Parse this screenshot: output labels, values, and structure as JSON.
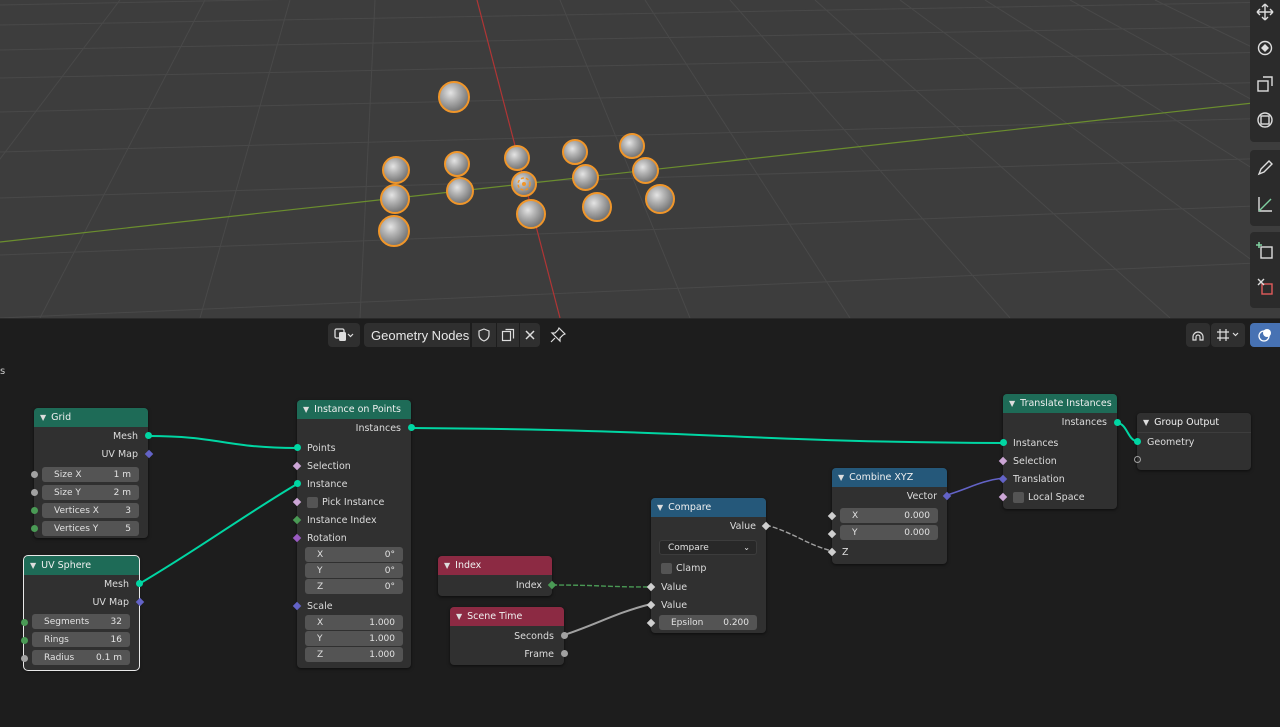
{
  "editor": {
    "tree_name": "Geometry Nodes",
    "partial_label": "s"
  },
  "colors": {
    "geometry": "#00d6a3",
    "float": "#a1a1a1",
    "vector": "#6363c7",
    "integer": "#4a9a55",
    "boolean": "#cca6d6",
    "selection_outline": "#f0962a"
  },
  "icons": {
    "editor_type": "node-editor-icon",
    "fake_user": "shield-icon",
    "duplicate": "copy-icon",
    "unlink": "close-icon",
    "pin": "pin-icon",
    "move": "move-icon",
    "rotate": "rotate-icon",
    "scale": "scale-icon",
    "transform": "transform-icon",
    "annotate": "pencil-icon",
    "measure": "ruler-icon",
    "add_cube": "add-cube-icon",
    "extrude": "extrude-icon",
    "snap": "snap-icon",
    "overlay": "overlay-icon"
  },
  "nodes": {
    "grid": {
      "title": "Grid",
      "out_mesh": "Mesh",
      "out_uvmap": "UV Map",
      "size_x_label": "Size X",
      "size_x_value": "1 m",
      "size_y_label": "Size Y",
      "size_y_value": "2 m",
      "vx_label": "Vertices X",
      "vx_value": "3",
      "vy_label": "Vertices Y",
      "vy_value": "5"
    },
    "uv_sphere": {
      "title": "UV Sphere",
      "out_mesh": "Mesh",
      "out_uvmap": "UV Map",
      "segments_label": "Segments",
      "segments_value": "32",
      "rings_label": "Rings",
      "rings_value": "16",
      "radius_label": "Radius",
      "radius_value": "0.1 m"
    },
    "instance_on_points": {
      "title": "Instance on Points",
      "out_instances": "Instances",
      "in_points": "Points",
      "in_selection": "Selection",
      "in_instance": "Instance",
      "pick_instance": "Pick Instance",
      "in_instance_index": "Instance Index",
      "in_rotation": "Rotation",
      "rot_x_label": "X",
      "rot_x_value": "0°",
      "rot_y_label": "Y",
      "rot_y_value": "0°",
      "rot_z_label": "Z",
      "rot_z_value": "0°",
      "in_scale": "Scale",
      "sc_x_label": "X",
      "sc_x_value": "1.000",
      "sc_y_label": "Y",
      "sc_y_value": "1.000",
      "sc_z_label": "Z",
      "sc_z_value": "1.000"
    },
    "index": {
      "title": "Index",
      "out_index": "Index"
    },
    "scene_time": {
      "title": "Scene Time",
      "out_seconds": "Seconds",
      "out_frame": "Frame"
    },
    "compare": {
      "title": "Compare",
      "out_value": "Value",
      "operation": "Compare",
      "clamp": "Clamp",
      "in_value_a": "Value",
      "in_value_b": "Value",
      "epsilon_label": "Epsilon",
      "epsilon_value": "0.200"
    },
    "combine_xyz": {
      "title": "Combine XYZ",
      "out_vector": "Vector",
      "x_label": "X",
      "x_value": "0.000",
      "y_label": "Y",
      "y_value": "0.000",
      "in_z": "Z"
    },
    "translate_instances": {
      "title": "Translate Instances",
      "out_instances": "Instances",
      "in_instances": "Instances",
      "in_selection": "Selection",
      "in_translation": "Translation",
      "local_space": "Local Space"
    },
    "group_output": {
      "title": "Group Output",
      "in_geometry": "Geometry"
    }
  }
}
